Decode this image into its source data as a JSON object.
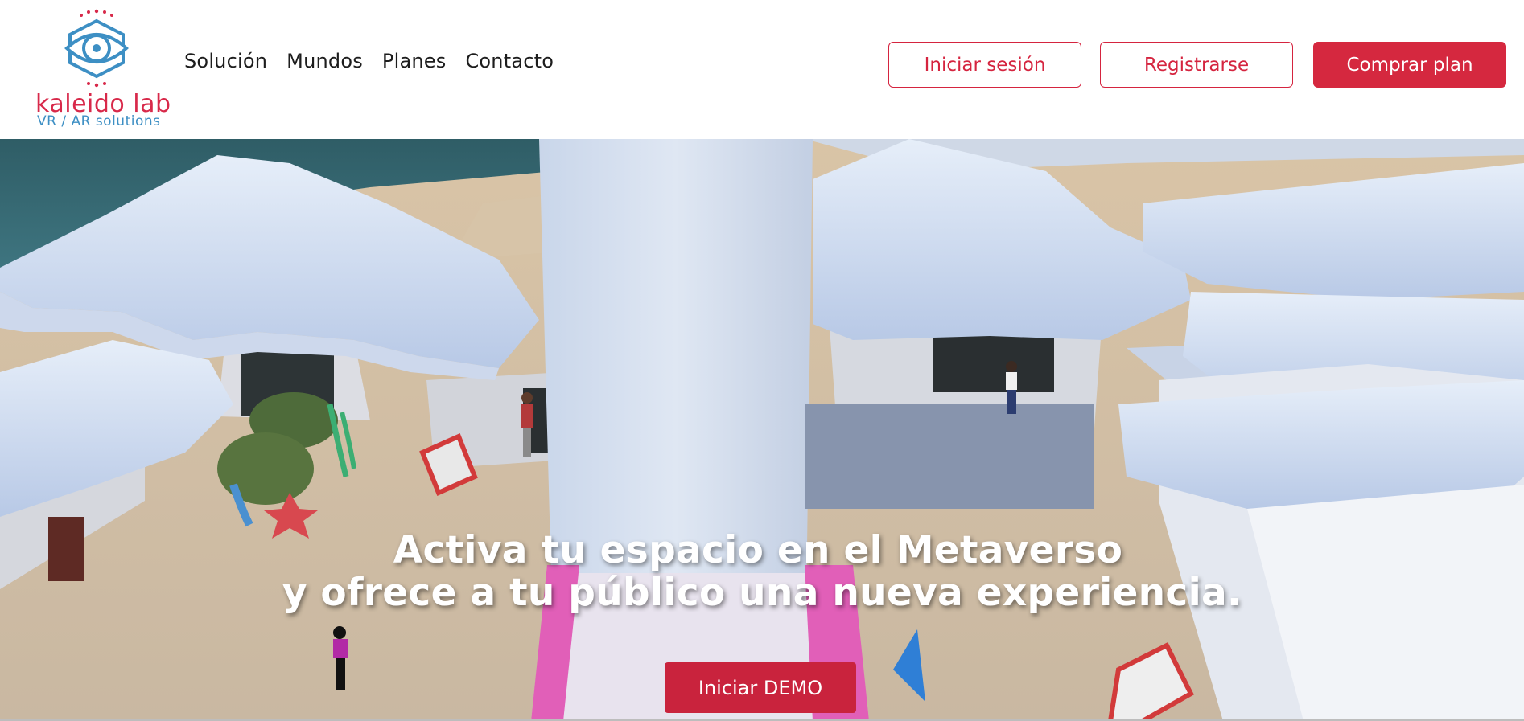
{
  "brand": {
    "name": "kaleido lab",
    "tagline": "VR / AR solutions",
    "colors": {
      "primary": "#d5243f",
      "logo_blue": "#3d8fc4"
    }
  },
  "nav": {
    "items": [
      "Solución",
      "Mundos",
      "Planes",
      "Contacto"
    ]
  },
  "header_actions": {
    "login": "Iniciar sesión",
    "register": "Registrarse",
    "buy": "Comprar plan"
  },
  "hero": {
    "title_line1": "Activa tu espacio en el Metaverso",
    "title_line2": "y ofrece a tu público una nueva experiencia.",
    "cta": "Iniciar DEMO",
    "image": "metaverse-world-scene"
  }
}
